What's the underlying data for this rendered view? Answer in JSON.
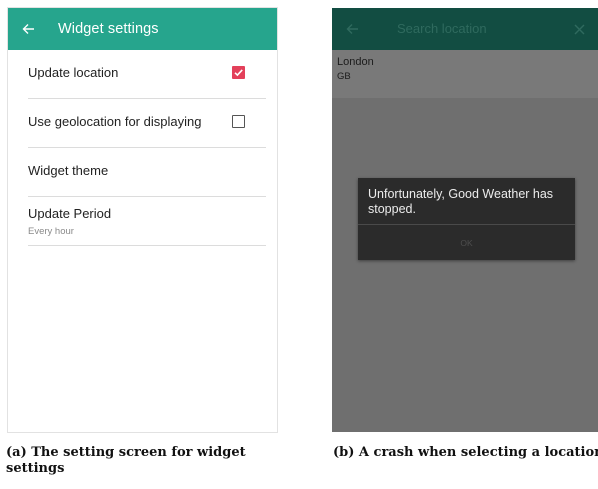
{
  "panel_a": {
    "header": {
      "back_icon": "arrow-left-icon",
      "title": "Widget settings"
    },
    "colors": {
      "appbar": "#26a58d",
      "checkbox_checked": "#e3405a"
    },
    "preferences": [
      {
        "label": "Update location",
        "checkbox": true
      },
      {
        "label": "Use geolocation for displaying",
        "checkbox": false
      },
      {
        "label": "Widget theme"
      },
      {
        "label": "Update Period",
        "summary": "Every hour"
      }
    ],
    "caption": "(a) The setting screen for widget settings"
  },
  "panel_b": {
    "header": {
      "back_icon": "arrow-left-icon",
      "search_placeholder": "Search location",
      "close_icon": "close-icon"
    },
    "colors": {
      "appbar": "#124d42",
      "overlay": "#6f6f6f",
      "dialog": "#2b2b2b"
    },
    "result": {
      "city": "London",
      "country": "GB"
    },
    "dialog": {
      "message": "Unfortunately, Good Weather has stopped.",
      "button": "OK"
    },
    "caption": "(b) A crash when selecting a location"
  }
}
